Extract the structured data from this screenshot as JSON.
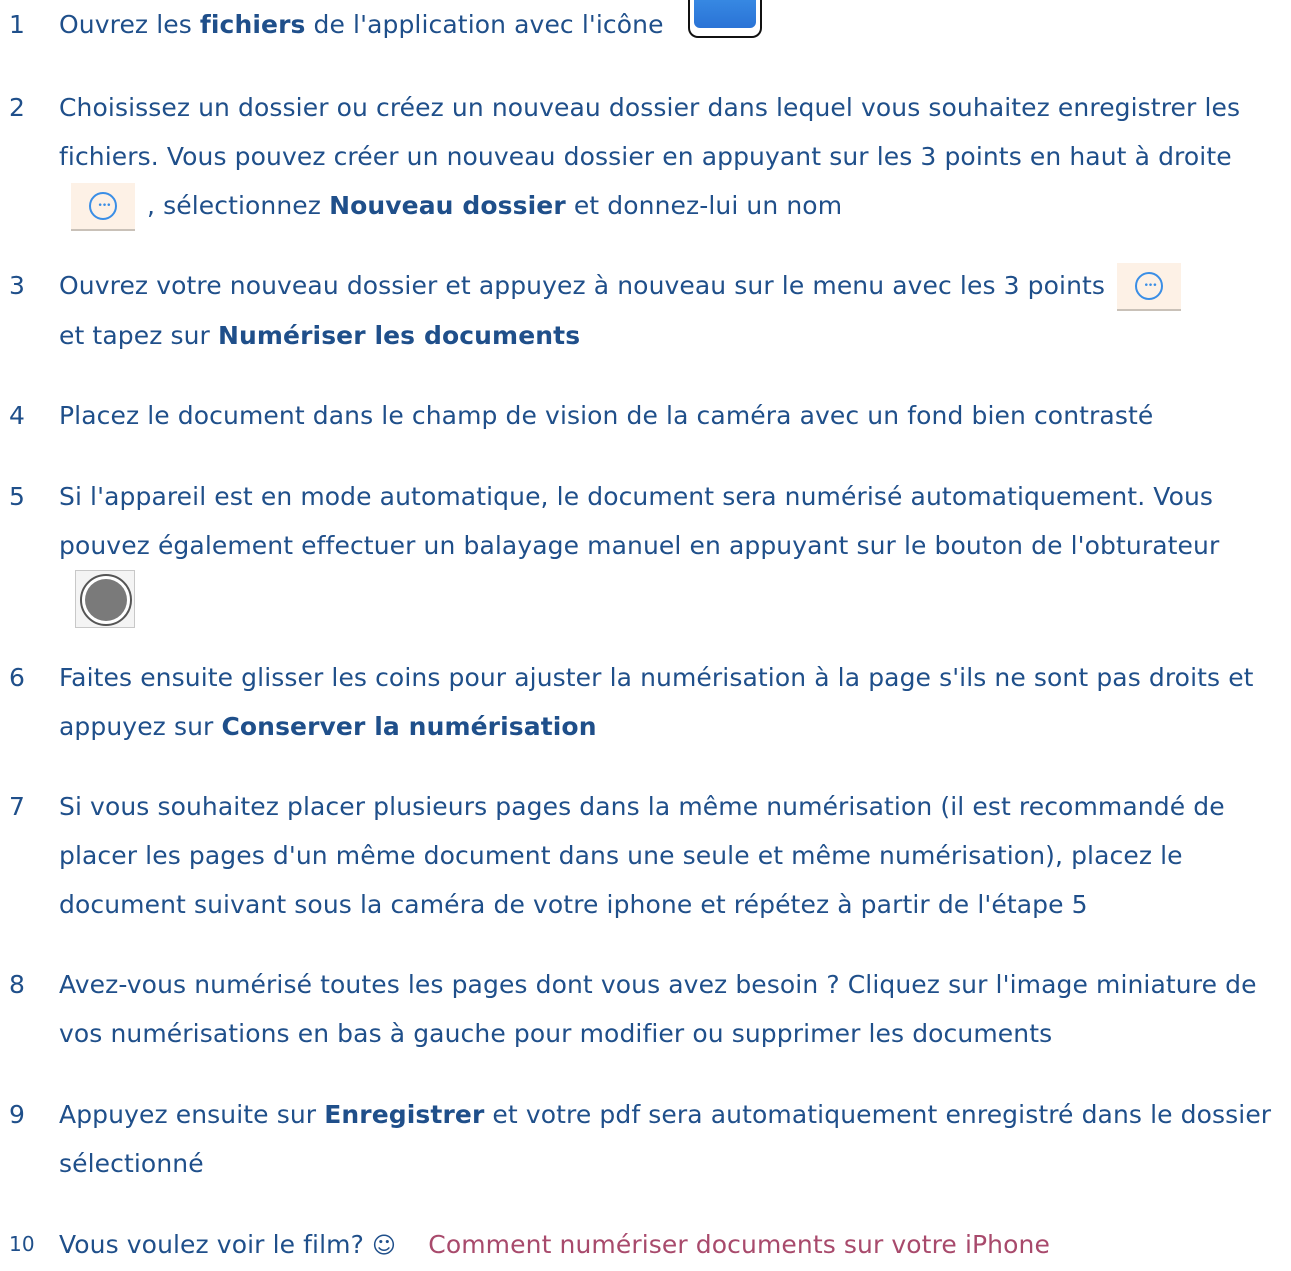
{
  "steps": [
    {
      "number": "1",
      "parts": [
        "Ouvrez les ",
        "fichiers",
        " de l'application avec l'icône"
      ]
    },
    {
      "number": "2",
      "parts": [
        "Choisissez un dossier ou créez un nouveau dossier dans lequel vous souhaitez enregistrer les fichiers. Vous pouvez créer un nouveau dossier en appuyant sur les 3 points en haut à droite",
        ", sélectionnez ",
        "Nouveau dossier",
        " et donnez-lui un nom"
      ]
    },
    {
      "number": "3",
      "parts": [
        "Ouvrez votre nouveau dossier et appuyez à nouveau sur le menu avec les 3 points",
        "et tapez sur ",
        "Numériser les documents"
      ]
    },
    {
      "number": "4",
      "parts": [
        "Placez le document dans le champ de vision de la caméra avec un fond bien contrasté"
      ]
    },
    {
      "number": "5",
      "parts": [
        "Si l'appareil est en mode automatique, le document sera numérisé automatiquement. Vous pouvez également effectuer un balayage manuel en appuyant sur le bouton de l'obturateur"
      ]
    },
    {
      "number": "6",
      "parts": [
        "Faites ensuite glisser les coins pour ajuster la numérisation à la page s'ils ne sont pas droits et appuyez sur ",
        "Conserver la numérisation"
      ]
    },
    {
      "number": "7",
      "parts": [
        "Si vous souhaitez placer plusieurs pages dans la même numérisation (il est recommandé de placer les pages d'un même document dans une seule et même numérisation), placez le document suivant sous la caméra de votre iphone et répétez à partir de l'étape 5"
      ]
    },
    {
      "number": "8",
      "parts": [
        "Avez-vous numérisé toutes les pages dont vous avez besoin ? Cliquez sur l'image miniature de vos numérisations en bas à gauche pour modifier ou supprimer les documents"
      ]
    },
    {
      "number": "9",
      "parts": [
        "Appuyez ensuite sur ",
        "Enregistrer",
        " et votre pdf sera automatiquement enregistré dans le dossier sélectionné"
      ]
    },
    {
      "number": "10",
      "parts": [
        "Vous voulez voir le film? ",
        "☺",
        "Comment numériser documents sur votre iPhone"
      ]
    }
  ],
  "icons": {
    "files": "files-app-icon",
    "dots": "ellipsis-circle-icon",
    "shutter": "shutter-button-icon"
  },
  "colors": {
    "text": "#1f4f8a",
    "link": "#a84a6c",
    "icon_accent": "#3a8ee6"
  }
}
